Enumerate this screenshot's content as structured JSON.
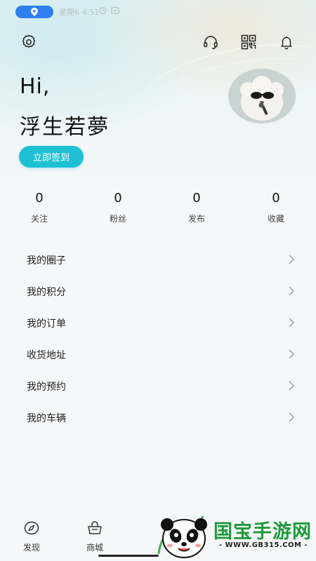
{
  "status_bar": {
    "text": "星期6 4:51"
  },
  "greeting": "Hi,",
  "username": "浮生若夢",
  "checkin_label": "立即签到",
  "stats": [
    {
      "value": "0",
      "label": "关注"
    },
    {
      "value": "0",
      "label": "粉丝"
    },
    {
      "value": "0",
      "label": "发布"
    },
    {
      "value": "0",
      "label": "收藏"
    }
  ],
  "menu": [
    {
      "label": "我的圈子"
    },
    {
      "label": "我的积分"
    },
    {
      "label": "我的订单"
    },
    {
      "label": "收货地址"
    },
    {
      "label": "我的预约"
    },
    {
      "label": "我的车辆"
    }
  ],
  "tabs": [
    {
      "label": "发现",
      "icon": "compass-icon"
    },
    {
      "label": "商城",
      "icon": "shopping-basket-icon"
    }
  ],
  "watermark": {
    "text": "国宝手游网",
    "url": "- WWW.GB315.COM -"
  },
  "colors": {
    "accent": "#1fc0d4",
    "location_pill": "#2f7ff0",
    "watermark_green": "#1f9a3c"
  }
}
